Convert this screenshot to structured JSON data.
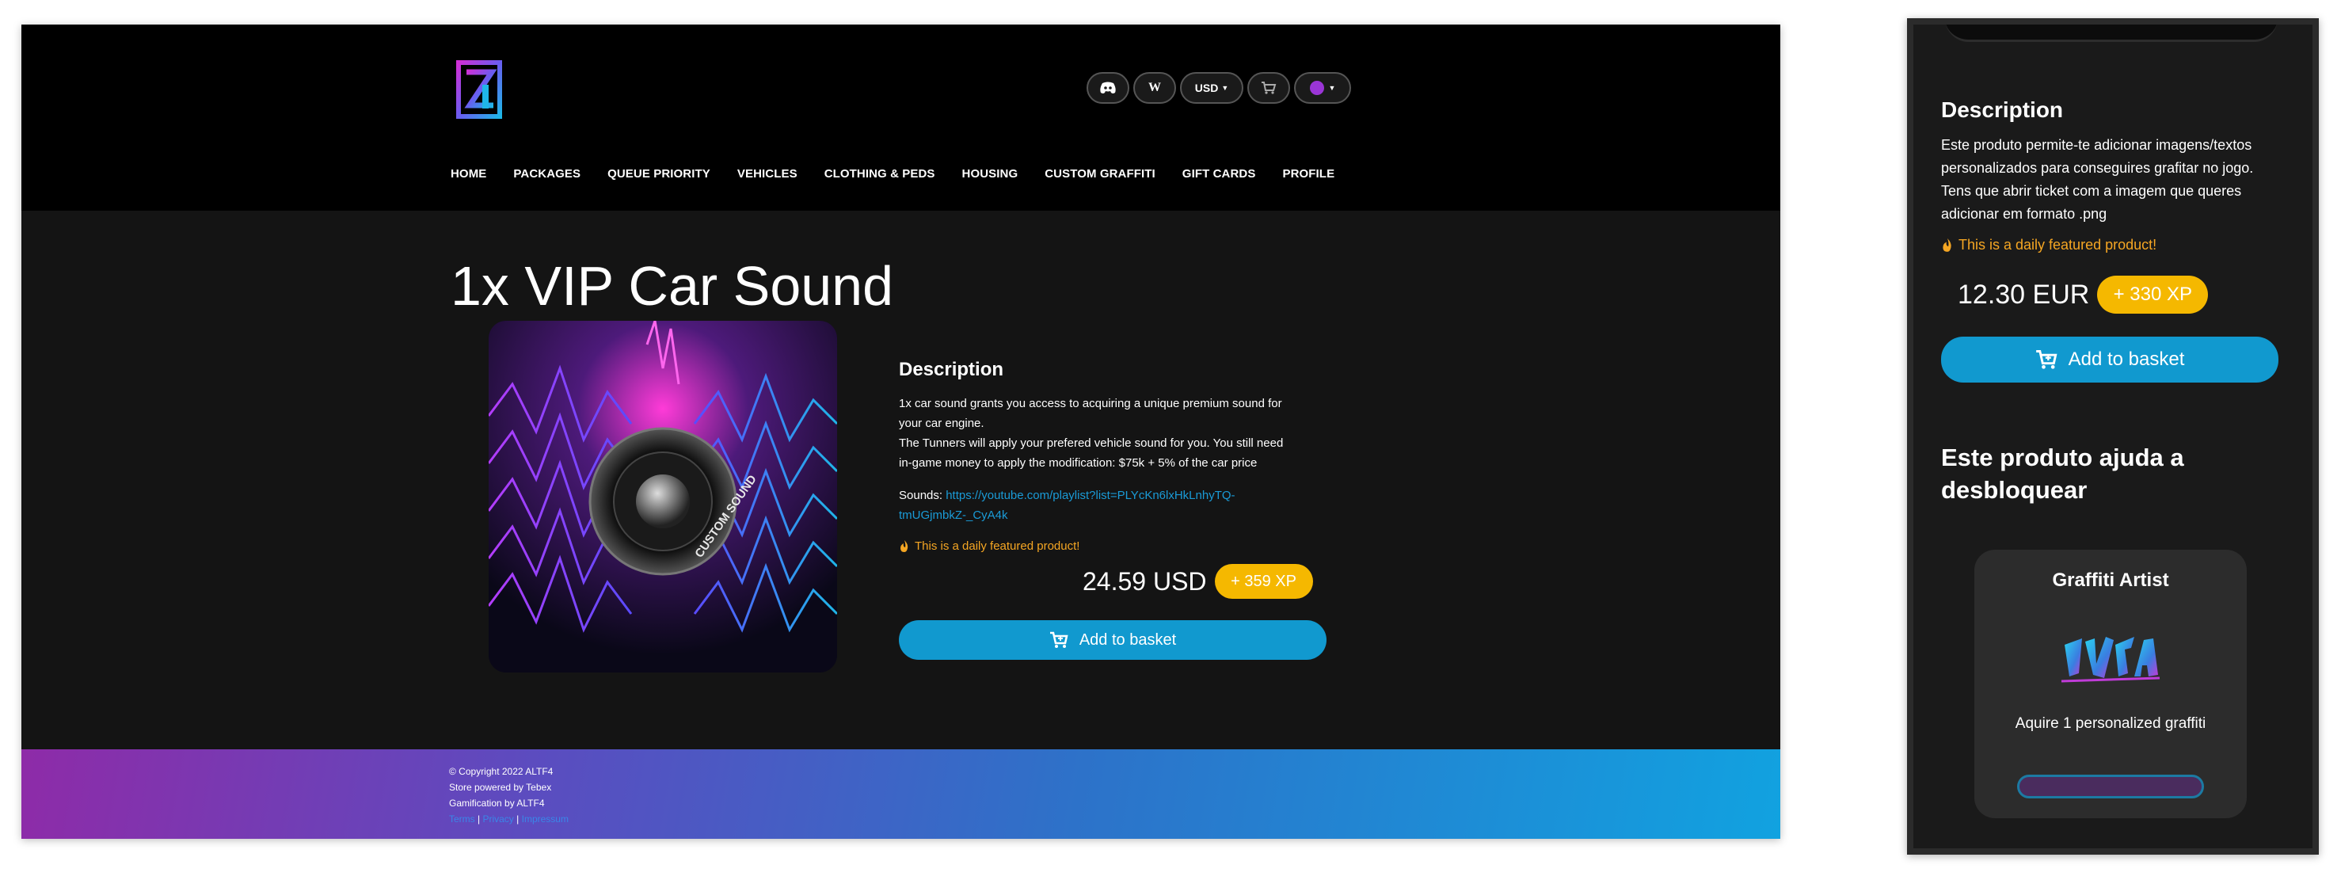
{
  "desktop": {
    "header": {
      "currency": "USD",
      "wiki_label": "W",
      "icons": [
        "discord-icon",
        "cart-icon",
        "user-avatar-icon"
      ]
    },
    "nav": [
      "HOME",
      "PACKAGES",
      "QUEUE PRIORITY",
      "VEHICLES",
      "CLOTHING & PEDS",
      "HOUSING",
      "CUSTOM GRAFFITI",
      "GIFT CARDS",
      "PROFILE"
    ],
    "product": {
      "title": "1x VIP Car Sound",
      "image_label": "CUSTOM SOUND",
      "description_heading": "Description",
      "description_lines": [
        "1x car sound grants you access to acquiring a unique premium sound for",
        "your car engine.",
        "The Tunners will apply your prefered vehicle sound for you. You still need",
        "in-game money to apply the modification: $75k + 5% of the car price"
      ],
      "sounds_label": "Sounds:",
      "sounds_link_line1": "https://youtube.com/playlist?list=PLYcKn6lxHkLnhyTQ-",
      "sounds_link_line2": "tmUGjmbkZ-_CyA4k",
      "featured_text": "This is a daily featured product!",
      "price": "24.59 USD",
      "xp": "+ 359 XP",
      "add_to_basket": "Add to basket"
    },
    "footer": {
      "copyright": "© Copyright 2022 ALTF4",
      "powered": "Store powered by Tebex",
      "gamification": "Gamification by ALTF4",
      "link_terms": "Terms",
      "link_privacy": "Privacy",
      "link_impressum": "Impressum",
      "separator": " | "
    }
  },
  "mobile": {
    "description_heading": "Description",
    "description_text": "Este produto permite-te adicionar imagens/textos personalizados para conseguires grafitar no jogo. Tens que abrir ticket com a imagem que queres adicionar em formato .png",
    "featured_text": "This is a daily featured product!",
    "price": "12.30 EUR",
    "xp": "+ 330 XP",
    "add_to_basket": "Add to basket",
    "unlock_heading": "Este produto ajuda a desbloquear",
    "achievement": {
      "title": "Graffiti Artist",
      "description": "Aquire 1 personalized graffiti"
    }
  },
  "colors": {
    "accent_blue": "#1199cf",
    "xp_yellow": "#f5b800",
    "featured_orange": "#f5a623",
    "link_blue": "#1a9bd7"
  }
}
